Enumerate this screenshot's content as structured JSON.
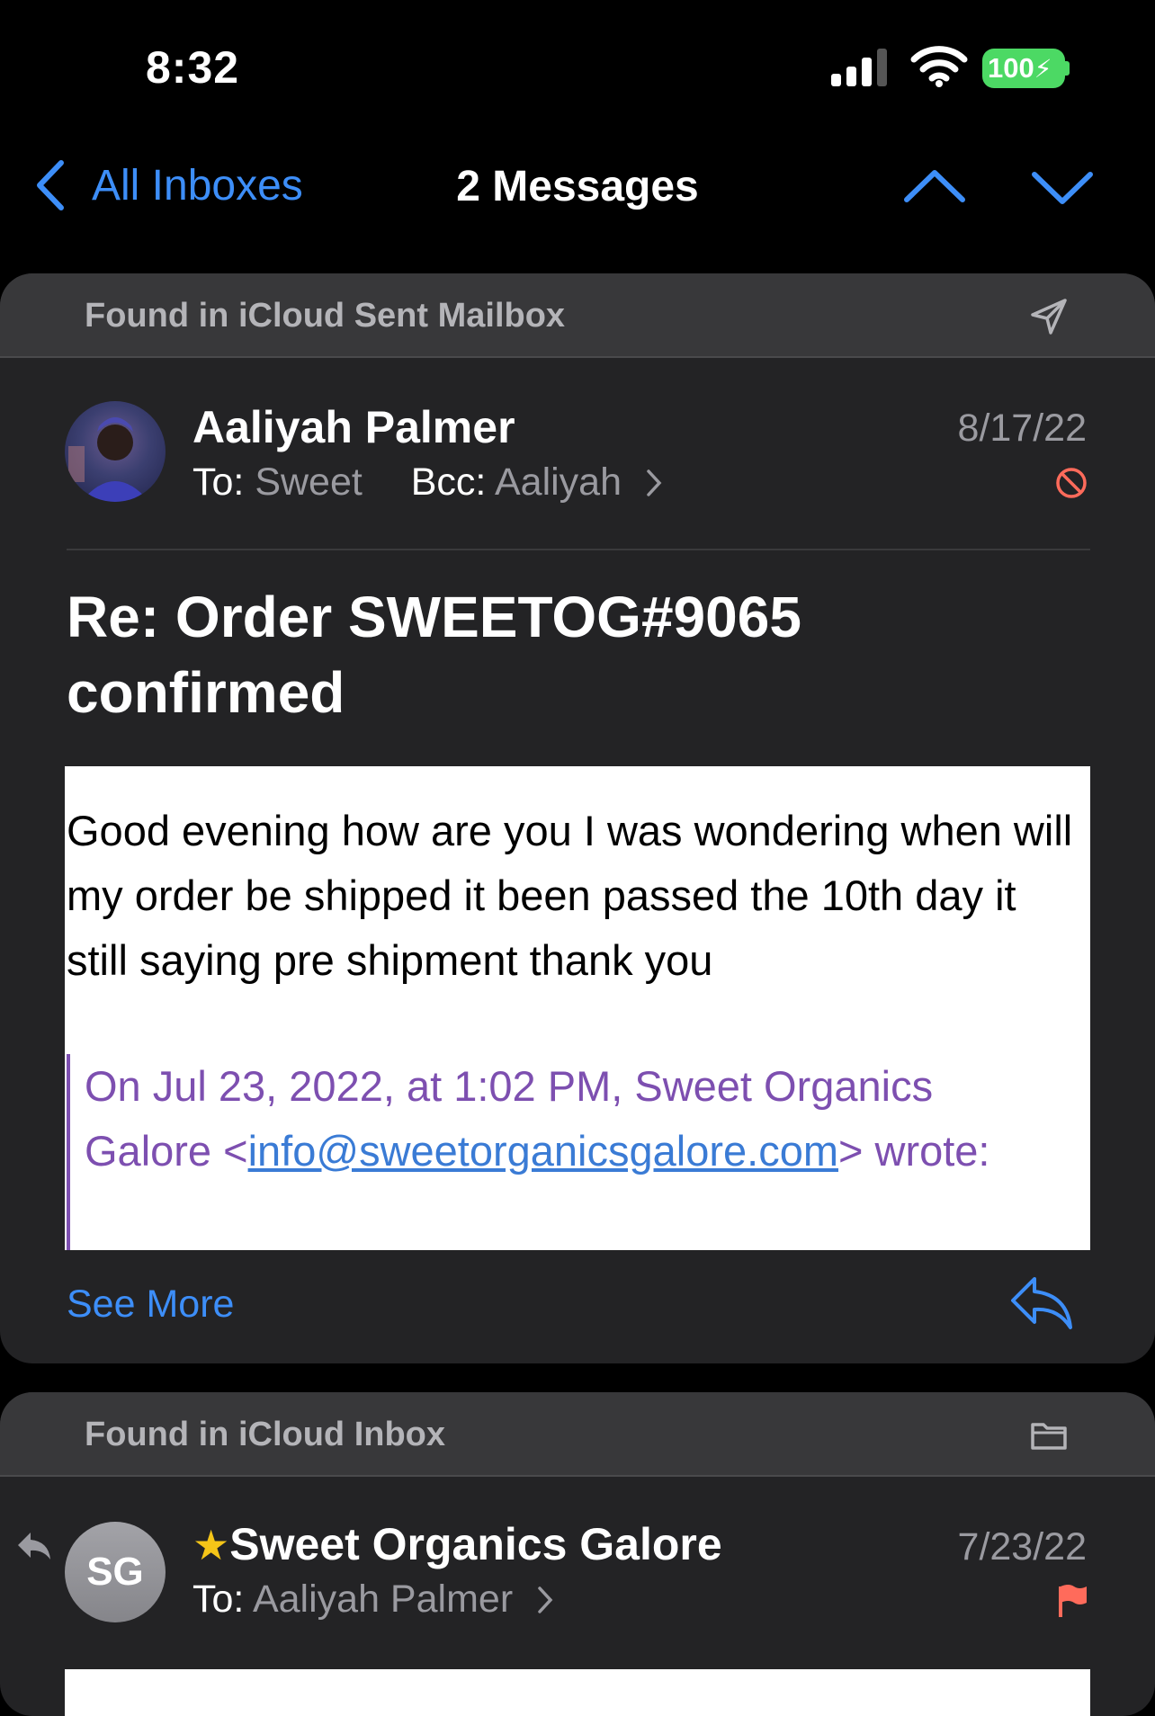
{
  "status_bar": {
    "time": "8:32",
    "battery": "100"
  },
  "nav": {
    "back_label": "All Inboxes",
    "title": "2 Messages"
  },
  "messages": [
    {
      "found_in": "Found in iCloud Sent Mailbox",
      "sender": "Aaliyah Palmer",
      "to_label": "To:",
      "to_value": "Sweet",
      "bcc_label": "Bcc:",
      "bcc_value": "Aaliyah",
      "date": "8/17/22",
      "subject": "Re: Order SWEETOG#9065 confirmed",
      "body": "Good evening how are you I was wondering when will my order be shipped it been passed the 10th day it still saying pre shipment thank you",
      "quote_prefix": "On Jul 23, 2022, at 1:02 PM, Sweet Organics Galore <",
      "quote_email": "info@sweetorganicsgalore.com",
      "quote_suffix": "> wrote:",
      "see_more": "See More"
    },
    {
      "found_in": "Found in iCloud Inbox",
      "avatar_initials": "SG",
      "star": "★",
      "sender": "Sweet Organics Galore",
      "to_label": "To:",
      "to_value": "Aaliyah Palmer",
      "date": "7/23/22"
    }
  ],
  "colors": {
    "accent": "#3d8ef8",
    "flag": "#ff6b5b",
    "quote": "#7d4fb0",
    "battery": "#4cd964"
  }
}
